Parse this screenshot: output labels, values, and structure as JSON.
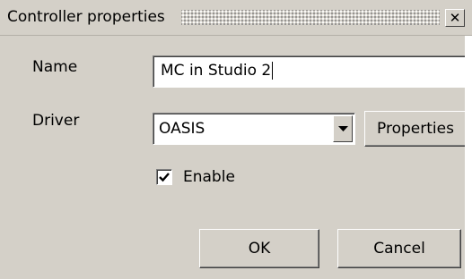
{
  "window": {
    "title": "Controller properties",
    "close_glyph": "✕"
  },
  "form": {
    "name_label": "Name",
    "name_value": "MC in Studio 2",
    "driver_label": "Driver",
    "driver_value": "OASIS",
    "properties_button": "Properties",
    "enable_label": "Enable",
    "enable_checked": true
  },
  "footer": {
    "ok_label": "OK",
    "cancel_label": "Cancel"
  },
  "icons": {
    "close": "close-icon",
    "dropdown": "chevron-down-icon",
    "check": "check-icon"
  },
  "colors": {
    "face": "#d4d0c8",
    "field": "#ffffff"
  }
}
